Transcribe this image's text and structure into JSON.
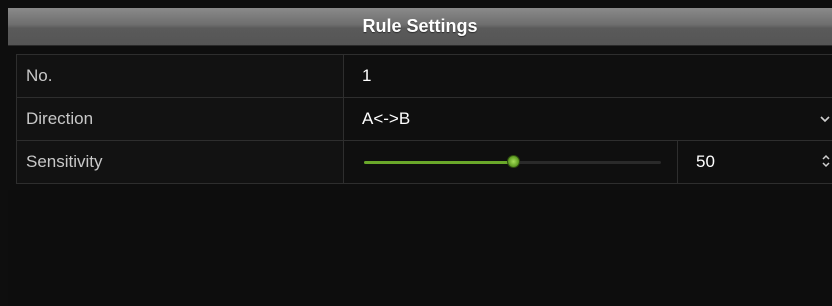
{
  "dialog": {
    "title": "Rule Settings"
  },
  "rows": {
    "number": {
      "label": "No.",
      "value": "1"
    },
    "direction": {
      "label": "Direction",
      "value": "A<->B",
      "icon": "chevron-down-icon"
    },
    "sensitivity": {
      "label": "Sensitivity",
      "value": "50",
      "level_percent": 50,
      "icon": "spinner-arrows-icon"
    }
  },
  "colors": {
    "slider_accent": "#6aa82a",
    "title_bar": "#6e6e6e",
    "background": "#0e0e0e"
  }
}
